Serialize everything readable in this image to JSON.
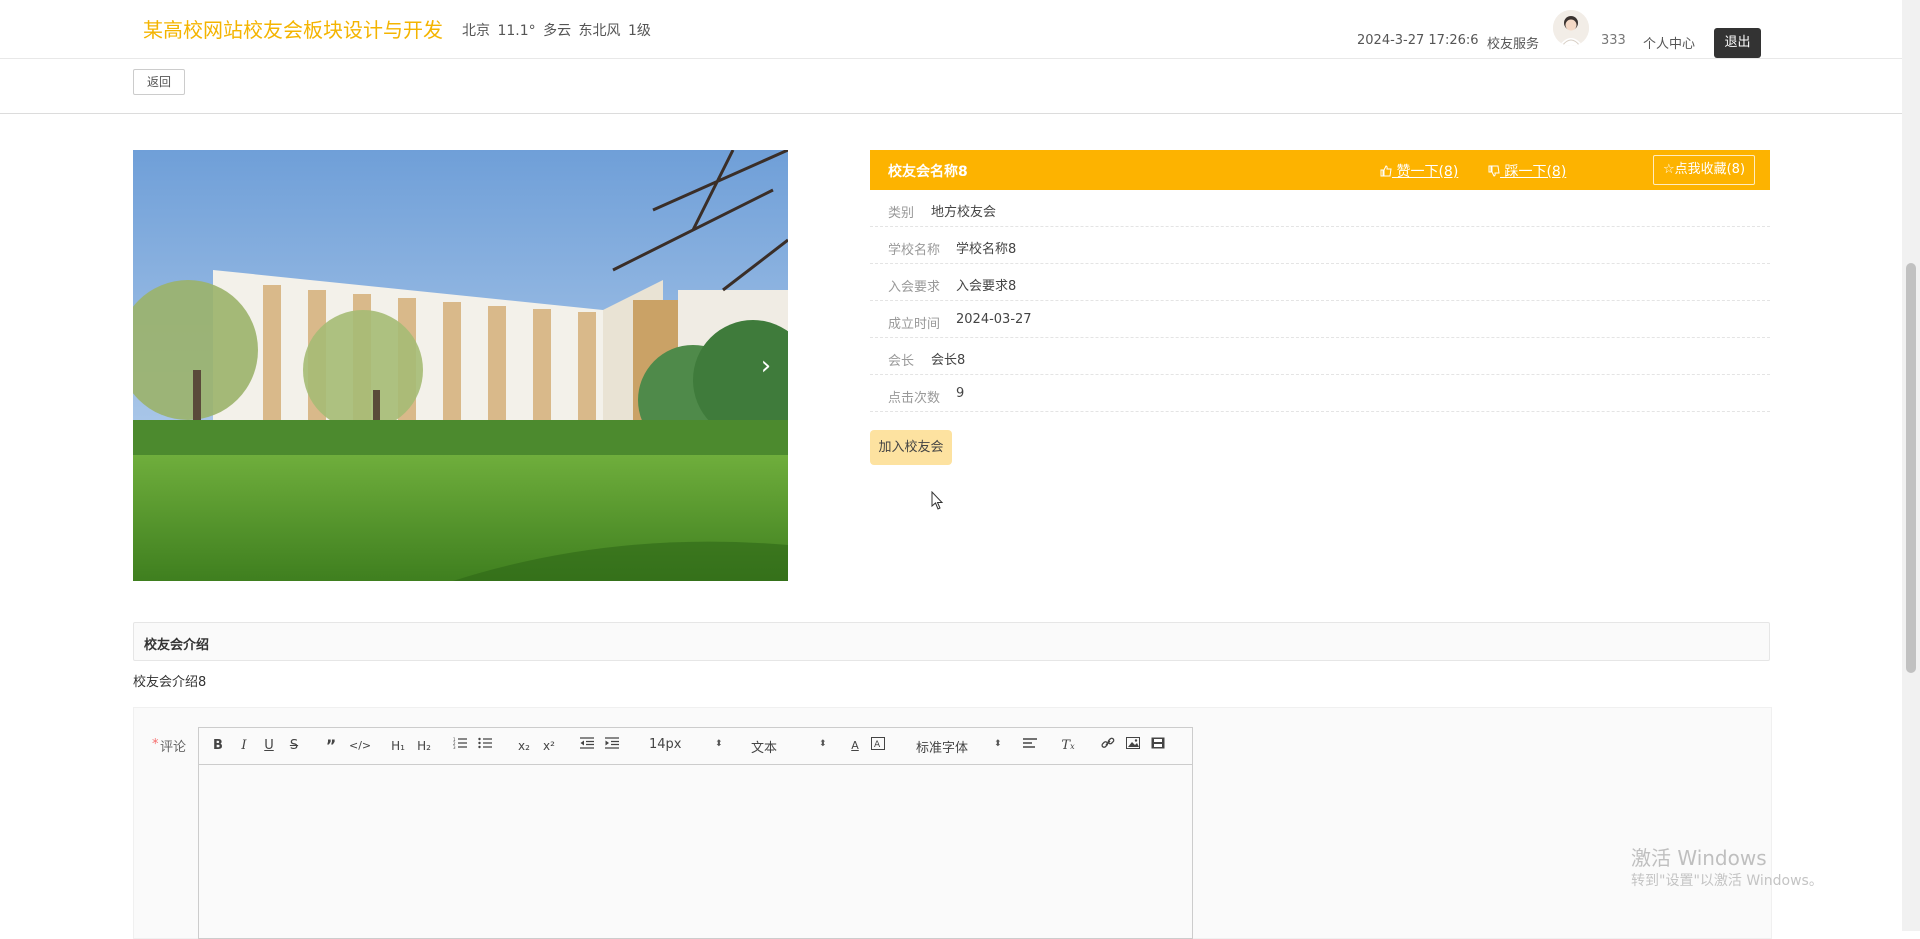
{
  "header": {
    "site_title": "某高校网站校友会板块设计与开发",
    "weather": "北京  11.1°  多云  东北风  1级",
    "datetime": "2024-3-27 17:26:6",
    "service": "校友服务",
    "username": "333",
    "personal_center": "个人中心",
    "logout": "退出"
  },
  "back_label": "返回",
  "detail": {
    "name": "校友会名称8",
    "like_label": "赞一下(8)",
    "dislike_label": "踩一下(8)",
    "favorite_label": "点我收藏(8)",
    "fields": [
      {
        "label": "类别",
        "value": "地方校友会"
      },
      {
        "label": "学校名称",
        "value": "学校名称8"
      },
      {
        "label": "入会要求",
        "value": "入会要求8"
      },
      {
        "label": "成立时间",
        "value": "2024-03-27"
      },
      {
        "label": "会长",
        "value": "会长8"
      },
      {
        "label": "点击次数",
        "value": "9"
      }
    ],
    "join_label": "加入校友会"
  },
  "intro": {
    "title": "校友会介绍",
    "text": "校友会介绍8"
  },
  "comment": {
    "required_mark": "*",
    "label": "评论",
    "font_size": "14px",
    "block_format": "文本",
    "font_family": "标准字体",
    "buttons": [
      "bold",
      "italic",
      "underline",
      "strike",
      "blockquote",
      "code",
      "h1",
      "h2",
      "ordered-list",
      "bullet-list",
      "subscript",
      "superscript",
      "outdent",
      "indent",
      "text-color",
      "background-color",
      "align",
      "clear-format",
      "link",
      "image",
      "video"
    ]
  },
  "watermark": {
    "line1": "激活 Windows",
    "line2": "转到\"设置\"以激活 Windows。"
  },
  "colors": {
    "brand": "#f4b400",
    "detail_header": "#fdb300",
    "join_button": "#fde2a0",
    "logout_button": "#333333"
  },
  "icons": {
    "like": "thumbs-up-icon",
    "dislike": "thumbs-down-icon",
    "favorite": "star-icon",
    "carousel_next": "chevron-right-icon"
  }
}
